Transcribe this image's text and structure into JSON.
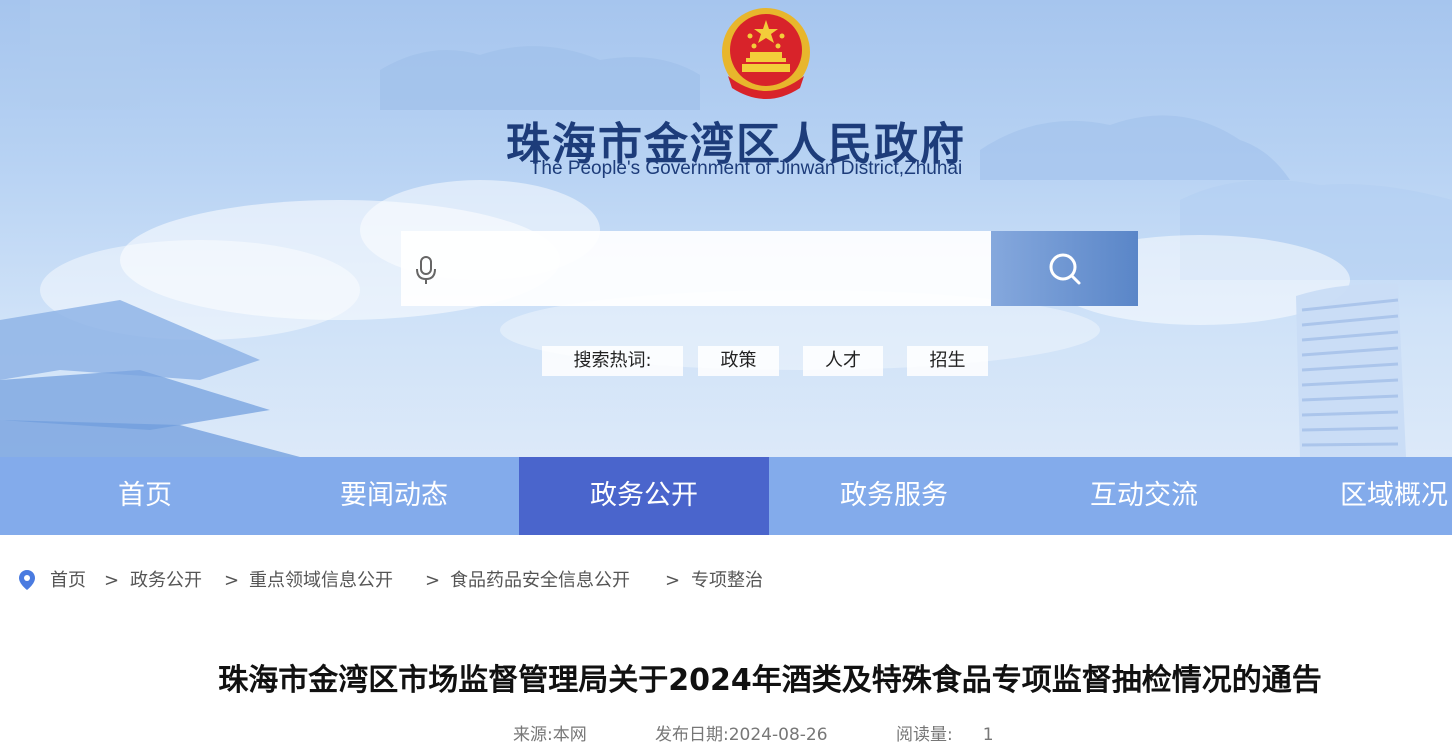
{
  "header": {
    "title": "珠海市金湾区人民政府",
    "subtitle": "The People's Government of Jinwan District,Zhuhai",
    "emblem_icon": "national-emblem-icon"
  },
  "search": {
    "value": "",
    "placeholder": "",
    "mic_icon": "microphone-icon",
    "button_icon": "search-icon",
    "hot_label": "搜索热词:",
    "hot_words": [
      "政策",
      "人才",
      "招生"
    ]
  },
  "nav": {
    "items": [
      "首页",
      "要闻动态",
      "政务公开",
      "政务服务",
      "互动交流",
      "区域概况"
    ],
    "active": "政务公开",
    "active_color": "#4a65cc"
  },
  "breadcrumb": {
    "icon": "location-pin-icon",
    "items": [
      "首页",
      "政务公开",
      "重点领域信息公开",
      "食品药品安全信息公开",
      "专项整治"
    ],
    "separator": ">"
  },
  "article": {
    "title": "珠海市金湾区市场监督管理局关于2024年酒类及特殊食品专项监督抽检情况的通告",
    "source_label": "来源:",
    "source_value": "本网",
    "date_label": "发布日期:",
    "date_value": "2024-08-26",
    "views_label": "阅读量:",
    "views_value": "1"
  },
  "colors": {
    "title_blue": "#1d3c7a",
    "nav_bg": "#6f9be6",
    "nav_active": "#4a65cc",
    "search_button": "#6a92d2"
  }
}
